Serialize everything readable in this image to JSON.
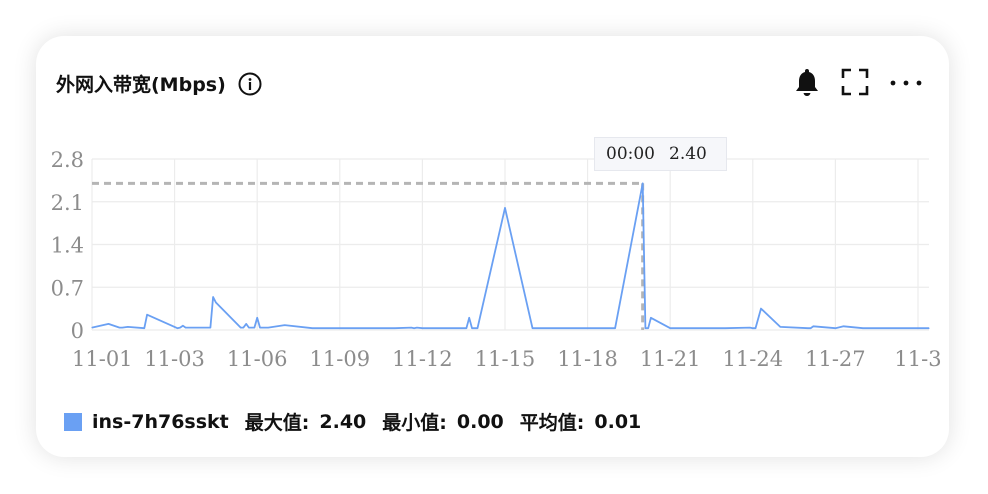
{
  "title": "外网入带宽(Mbps)",
  "icons": {
    "info": "info-circle-icon",
    "alarm": "bell-icon",
    "fullscreen": "fullscreen-icon",
    "more": "more-dots-icon"
  },
  "colors": {
    "series": "#6aa0f3",
    "grid": "#ececec",
    "axis_text": "#8c8c8c",
    "dash": "#b5b5b5"
  },
  "tooltip": {
    "time": "00:00",
    "value": "2.40"
  },
  "legend": {
    "series_name": "ins-7h76sskt",
    "max_label": "最大值:",
    "max_value": "2.40",
    "min_label": "最小值:",
    "min_value": "0.00",
    "avg_label": "平均值:",
    "avg_value": "0.01"
  },
  "chart_data": {
    "type": "line",
    "title": "外网入带宽(Mbps)",
    "xlabel": "",
    "ylabel": "",
    "ylim": [
      0,
      2.8
    ],
    "yticks": [
      "0",
      "0.7",
      "1.4",
      "2.1",
      "2.8"
    ],
    "xticks": [
      "11-01",
      "11-03",
      "11-06",
      "11-09",
      "11-12",
      "11-15",
      "11-18",
      "11-21",
      "11-24",
      "11-27",
      "11-3"
    ],
    "grid": true,
    "legend_position": "bottom-left",
    "series": [
      {
        "name": "ins-7h76sskt",
        "x_days": [
          0,
          0.6,
          1.0,
          1.1,
          1.3,
          1.9,
          2.0,
          3.1,
          3.2,
          3.3,
          3.4,
          4.0,
          4.3,
          4.4,
          4.5,
          5.4,
          5.5,
          5.6,
          5.7,
          5.9,
          6.0,
          6.1,
          6.4,
          7.0,
          8.0,
          9.0,
          10.0,
          11.0,
          11.6,
          11.7,
          11.8,
          12.0,
          13.0,
          13.6,
          13.7,
          13.8,
          14.0,
          15.0,
          16.0,
          17.0,
          17.9,
          18.0,
          18.1,
          19.0,
          20.0,
          20.1,
          20.2,
          20.3,
          21.0,
          22.0,
          23.0,
          23.9,
          24.0,
          24.1,
          24.3,
          25.0,
          26.0,
          26.1,
          26.2,
          27.0,
          27.3,
          28.0,
          29.0,
          30.0,
          30.4
        ],
        "values": [
          0.04,
          0.1,
          0.04,
          0.04,
          0.05,
          0.03,
          0.25,
          0.03,
          0.04,
          0.07,
          0.04,
          0.04,
          0.04,
          0.54,
          0.45,
          0.04,
          0.04,
          0.1,
          0.04,
          0.04,
          0.2,
          0.04,
          0.04,
          0.08,
          0.03,
          0.03,
          0.03,
          0.03,
          0.04,
          0.03,
          0.04,
          0.03,
          0.03,
          0.03,
          0.2,
          0.03,
          0.03,
          2.0,
          0.03,
          0.03,
          0.03,
          0.03,
          0.03,
          0.03,
          2.4,
          0.03,
          0.03,
          0.2,
          0.03,
          0.03,
          0.03,
          0.04,
          0.03,
          0.03,
          0.35,
          0.05,
          0.03,
          0.03,
          0.06,
          0.03,
          0.06,
          0.03,
          0.03,
          0.03,
          0.03
        ]
      }
    ],
    "highlight": {
      "x_label": "00:00",
      "y": 2.4
    }
  }
}
